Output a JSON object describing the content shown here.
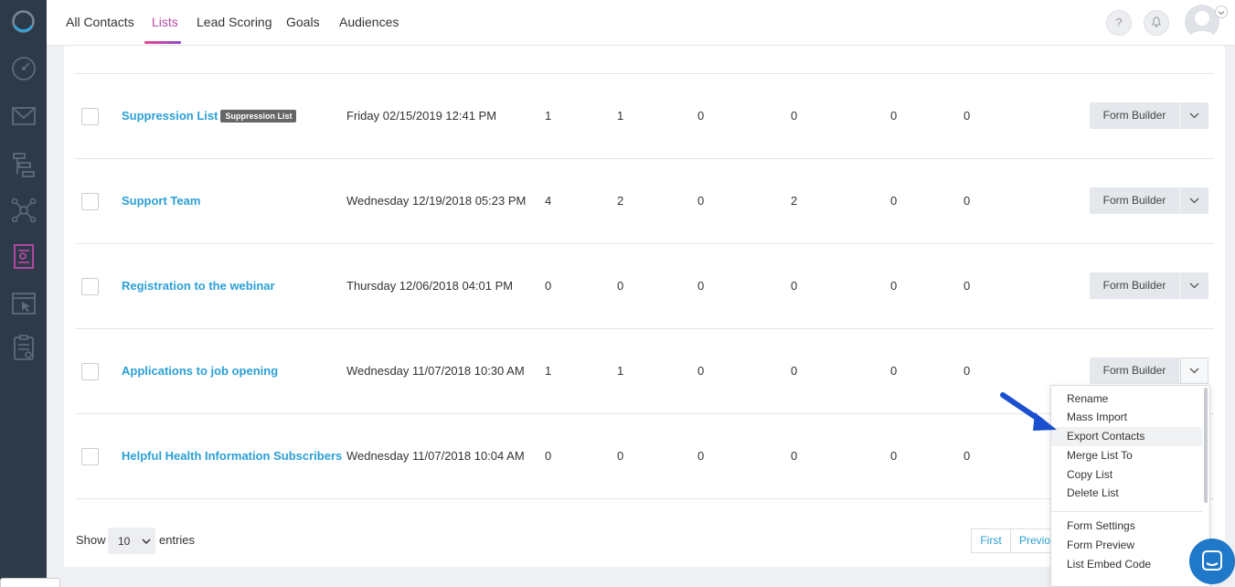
{
  "nav": {
    "tabs": [
      {
        "label": "All Contacts"
      },
      {
        "label": "Lists"
      },
      {
        "label": "Lead Scoring"
      },
      {
        "label": "Goals"
      },
      {
        "label": "Audiences"
      }
    ],
    "active_tab": "Lists",
    "help_label": "?"
  },
  "sidebar": {
    "icons": [
      "dashboard-icon",
      "email-icon",
      "automation-icon",
      "network-icon",
      "contacts-icon",
      "landing-page-icon",
      "forms-icon"
    ]
  },
  "colors": {
    "accent": "#b84aa4",
    "link": "#2a9fd6",
    "sidebar_bg": "#2d3a4a",
    "arrow": "#1a4fd0",
    "chat": "#1f78c8"
  },
  "rows": [
    {
      "name": "Suppression List",
      "tag": "Suppression List",
      "date": "Friday 02/15/2019 12:41 PM",
      "values": [
        "1",
        "1",
        "0",
        "0",
        "0",
        "0"
      ],
      "button": "Form Builder"
    },
    {
      "name": "Support Team",
      "tag": "",
      "date": "Wednesday 12/19/2018 05:23 PM",
      "values": [
        "4",
        "2",
        "0",
        "2",
        "0",
        "0"
      ],
      "button": "Form Builder"
    },
    {
      "name": "Registration to the webinar",
      "tag": "",
      "date": "Thursday 12/06/2018 04:01 PM",
      "values": [
        "0",
        "0",
        "0",
        "0",
        "0",
        "0"
      ],
      "button": "Form Builder"
    },
    {
      "name": "Applications to job opening",
      "tag": "",
      "date": "Wednesday 11/07/2018 10:30 AM",
      "values": [
        "1",
        "1",
        "0",
        "0",
        "0",
        "0"
      ],
      "button": "Form Builder"
    },
    {
      "name": "Helpful Health Information Subscribers",
      "tag": "",
      "date": "Wednesday 11/07/2018 10:04 AM",
      "values": [
        "0",
        "0",
        "0",
        "0",
        "0",
        "0"
      ],
      "button": "Form Builder"
    }
  ],
  "footer": {
    "show_label": "Show",
    "page_size": "10",
    "entries_label": "entries",
    "first_label": "First",
    "previous_label": "Previous"
  },
  "dropdown": {
    "items": [
      "Rename",
      "Mass Import",
      "Export Contacts",
      "Merge List To",
      "Copy List",
      "Delete List"
    ],
    "items2": [
      "Form Settings",
      "Form Preview",
      "List Embed Code"
    ],
    "highlighted": "Export Contacts"
  }
}
